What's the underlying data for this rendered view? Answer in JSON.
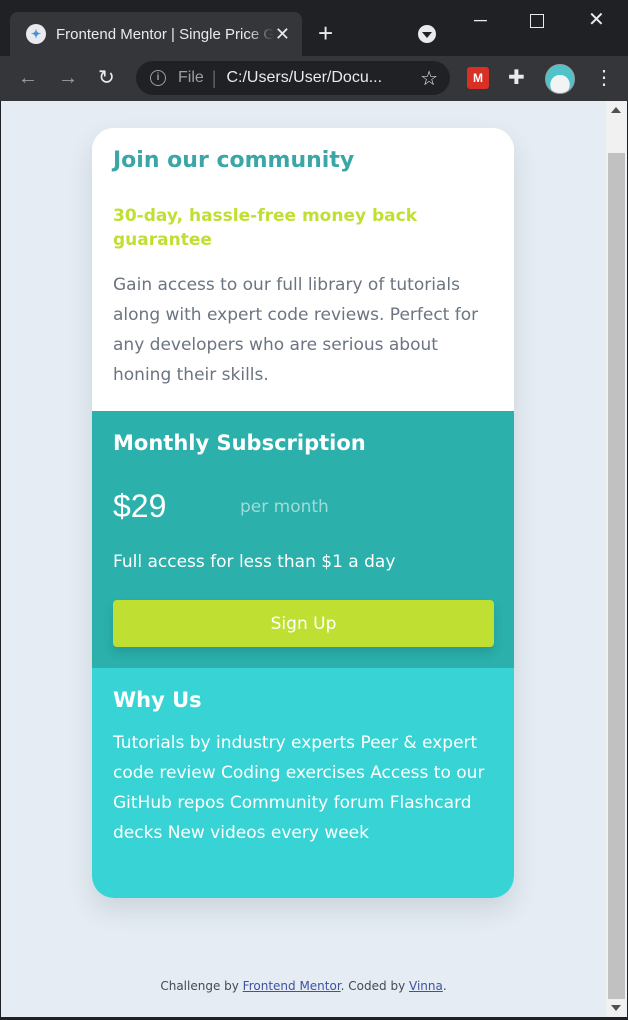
{
  "browser": {
    "tab_title": "Frontend Mentor | Single Price Grid Component",
    "tab_close": "✕",
    "new_tab": "+",
    "address_scheme": "File",
    "address_url": "C:/Users/User/Docu...",
    "icons": [
      "globe-favicon",
      "close-icon",
      "plus-icon",
      "tab-search-icon",
      "minimize-icon",
      "maximize-icon",
      "window-close-icon",
      "back-arrow-icon",
      "forward-arrow-icon",
      "reload-icon",
      "info-icon",
      "star-icon",
      "extension-icon",
      "puzzle-icon",
      "profile-avatar",
      "kebab-menu-icon"
    ]
  },
  "card": {
    "top": {
      "title": "Join our community",
      "guarantee": "30-day, hassle-free money back guarantee",
      "description": "Gain access to our full library of tutorials along with expert code reviews. Perfect for any developers who are serious about honing their skills."
    },
    "subscription": {
      "title": "Monthly Subscription",
      "price": "$29",
      "period": "per month",
      "tagline": "Full access for less than $1 a day",
      "button_label": "Sign Up"
    },
    "why_us": {
      "title": "Why Us",
      "text": "Tutorials by industry experts Peer & expert code review Coding exercises Access to our GitHub repos Community forum Flashcard decks New videos every week"
    }
  },
  "attribution": {
    "prefix": "Challenge by ",
    "link1": "Frontend Mentor",
    "middle": ". Coded by ",
    "link2": "Vinna",
    "suffix": "."
  },
  "colors": {
    "page_bg": "#e5ecf3",
    "cyan_title": "#3aa6a8",
    "lime": "#bfdf32",
    "teal_dark": "#2bb0ac",
    "teal_light": "#38d4d5"
  }
}
